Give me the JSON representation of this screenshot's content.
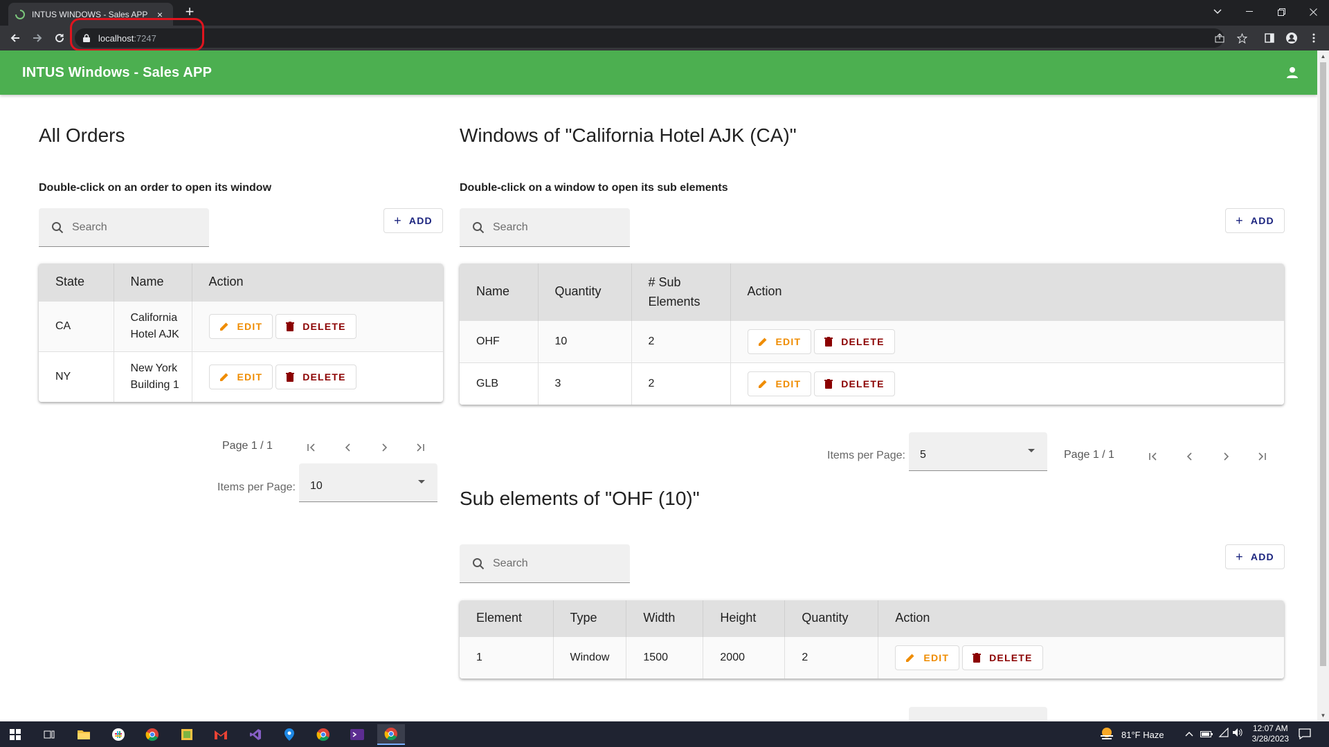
{
  "browser": {
    "tab_title": "INTUS WINDOWS - Sales APP",
    "tab_close": "×",
    "new_tab": "+",
    "url_host": "localhost",
    "url_port": ":7247"
  },
  "app": {
    "title": "INTUS Windows - Sales APP",
    "accent_color": "#4caf50"
  },
  "orders": {
    "heading": "All Orders",
    "hint": "Double-click on an order to open its window",
    "search_placeholder": "Search",
    "add_label": "ADD",
    "columns": [
      "State",
      "Name",
      "Action"
    ],
    "rows": [
      {
        "state": "CA",
        "name_line1": "California",
        "name_line2": "Hotel AJK"
      },
      {
        "state": "NY",
        "name_line1": "New York",
        "name_line2": "Building 1"
      }
    ],
    "page_text": "Page 1 / 1",
    "items_per_page_label": "Items per Page:",
    "items_per_page_value": "10"
  },
  "windows": {
    "heading": "Windows of \"California Hotel AJK (CA)\"",
    "hint": "Double-click on a window to open its sub elements",
    "search_placeholder": "Search",
    "add_label": "ADD",
    "columns": [
      "Name",
      "Quantity",
      "# Sub",
      "Elements",
      "Action"
    ],
    "rows": [
      {
        "name": "OHF",
        "quantity": "10",
        "sub": "2"
      },
      {
        "name": "GLB",
        "quantity": "3",
        "sub": "2"
      }
    ],
    "items_per_page_label": "Items per Page:",
    "items_per_page_value": "5",
    "page_text": "Page 1 / 1"
  },
  "subelements": {
    "heading": "Sub elements of \"OHF (10)\"",
    "search_placeholder": "Search",
    "add_label": "ADD",
    "columns": [
      "Element",
      "Type",
      "Width",
      "Height",
      "Quantity",
      "Action"
    ],
    "rows": [
      {
        "element": "1",
        "type": "Window",
        "width": "1500",
        "height": "2000",
        "quantity": "2"
      }
    ]
  },
  "actions": {
    "edit_label": "EDIT",
    "delete_label": "DELETE"
  },
  "taskbar": {
    "weather": "81°F  Haze",
    "time": "12:07 AM",
    "date": "3/28/2023"
  }
}
